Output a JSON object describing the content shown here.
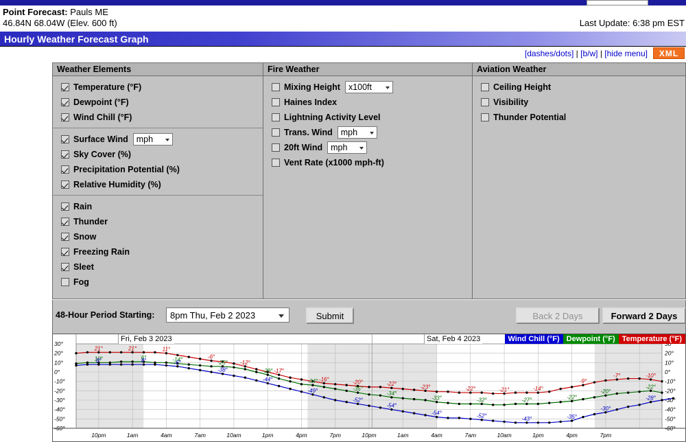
{
  "header": {
    "point_forecast_label": "Point Forecast:",
    "location": "Pauls ME",
    "coords": "46.84N 68.04W (Elev. 600 ft)",
    "last_update": "Last Update: 6:38 pm EST",
    "title": "Hourly Weather Forecast Graph"
  },
  "links": {
    "dashes_dots": "[dashes/dots]",
    "bw": "[b/w]",
    "hide_menu": "[hide menu]",
    "xml": "XML",
    "separator": "|"
  },
  "panels": [
    {
      "id": "weather-elements",
      "title": "Weather Elements",
      "groups": [
        {
          "items": [
            {
              "label": "Temperature (°F)",
              "checked": true
            },
            {
              "label": "Dewpoint (°F)",
              "checked": true
            },
            {
              "label": "Wind Chill (°F)",
              "checked": true
            }
          ]
        },
        {
          "divided": true,
          "items": [
            {
              "label": "Surface Wind",
              "checked": true,
              "select": "mph"
            },
            {
              "label": "Sky Cover (%)",
              "checked": true
            },
            {
              "label": "Precipitation Potential (%)",
              "checked": true
            },
            {
              "label": "Relative Humidity (%)",
              "checked": true
            }
          ]
        },
        {
          "divided": true,
          "items": [
            {
              "label": "Rain",
              "checked": true
            },
            {
              "label": "Thunder",
              "checked": true
            },
            {
              "label": "Snow",
              "checked": true
            },
            {
              "label": "Freezing Rain",
              "checked": true
            },
            {
              "label": "Sleet",
              "checked": true
            },
            {
              "label": "Fog",
              "checked": false
            }
          ]
        }
      ]
    },
    {
      "id": "fire-weather",
      "title": "Fire Weather",
      "groups": [
        {
          "items": [
            {
              "label": "Mixing Height",
              "checked": false,
              "select": "x100ft"
            },
            {
              "label": "Haines Index",
              "checked": false
            },
            {
              "label": "Lightning Activity Level",
              "checked": false
            },
            {
              "label": "Trans. Wind",
              "checked": false,
              "select": "mph"
            },
            {
              "label": "20ft Wind",
              "checked": false,
              "select": "mph"
            },
            {
              "label": "Vent Rate (x1000 mph-ft)",
              "checked": false
            }
          ]
        }
      ]
    },
    {
      "id": "aviation-weather",
      "title": "Aviation Weather",
      "groups": [
        {
          "items": [
            {
              "label": "Ceiling Height",
              "checked": false
            },
            {
              "label": "Visibility",
              "checked": false
            },
            {
              "label": "Thunder Potential",
              "checked": false
            }
          ]
        }
      ]
    }
  ],
  "controls": {
    "period_label": "48-Hour Period Starting:",
    "period_value": "8pm Thu, Feb 2 2023",
    "submit_label": "Submit",
    "back_label": "Back 2 Days",
    "forward_label": "Forward 2 Days"
  },
  "chart_data": {
    "type": "line",
    "title": "Hourly Weather Forecast Graph",
    "xlabel": "",
    "ylabel": "°F",
    "ylim": [
      -60,
      30
    ],
    "ytick_labels": [
      "30°",
      "20°",
      "10°",
      "0°",
      "-10°",
      "-20°",
      "-30°",
      "-40°",
      "-50°",
      "-60°"
    ],
    "yticks": [
      30,
      20,
      10,
      0,
      -10,
      -20,
      -30,
      -40,
      -50,
      -60
    ],
    "grid": true,
    "legend_position": "top-right",
    "day_labels": [
      "Fri, Feb 3 2023",
      "Sat, Feb 4 2023"
    ],
    "xtick_labels": [
      "10pm",
      "1am",
      "4am",
      "7am",
      "10am",
      "1pm",
      "4pm",
      "7pm",
      "10pm",
      "1am",
      "4am",
      "7am",
      "10am",
      "1pm",
      "4pm",
      "7pm"
    ],
    "x_hours": [
      "8pm",
      "9pm",
      "10pm",
      "11pm",
      "12am",
      "1am",
      "2am",
      "3am",
      "4am",
      "5am",
      "6am",
      "7am",
      "8am",
      "9am",
      "10am",
      "11am",
      "12pm",
      "1pm",
      "2pm",
      "3pm",
      "4pm",
      "5pm",
      "6pm",
      "7pm",
      "8pm",
      "9pm",
      "10pm",
      "11pm",
      "12am",
      "1am",
      "2am",
      "3am",
      "4am",
      "5am",
      "6am",
      "7am",
      "8am",
      "9am",
      "10am",
      "11am",
      "12pm",
      "1pm",
      "2pm",
      "3pm",
      "4pm",
      "5pm",
      "6pm",
      "7pm"
    ],
    "series": [
      {
        "name": "Temperature (°F)",
        "color": "#cc0000",
        "values": [
          20,
          21,
          21,
          21,
          21,
          21,
          21,
          21,
          20,
          18,
          16,
          14,
          12,
          11,
          9,
          6,
          3,
          0,
          -3,
          -6,
          -8,
          -10,
          -12,
          -13,
          -14,
          -15,
          -16,
          -16,
          -17,
          -18,
          -19,
          -20,
          -21,
          -21,
          -22,
          -22,
          -22,
          -23,
          -23,
          -22,
          -22,
          -22,
          -21,
          -18,
          -16,
          -14,
          -11,
          -9,
          -8,
          -7,
          -7,
          -8,
          -10
        ],
        "labels": [
          {
            "x": "10pm",
            "text": "21°"
          },
          {
            "x": "2am",
            "text": "21°"
          },
          {
            "x": "8am",
            "text": "11°"
          },
          {
            "x": "3pm",
            "text": "-6°"
          },
          {
            "x": "7pm",
            "text": "-12°"
          },
          {
            "x": "11pm",
            "text": "-17°"
          },
          {
            "x": "3am",
            "text": "-16°"
          },
          {
            "x": "7am",
            "text": "-20°"
          },
          {
            "x": "11am",
            "text": "-22°"
          },
          {
            "x": "3pm",
            "text": "-23°"
          },
          {
            "x": "7pm",
            "text": "-22°"
          },
          {
            "x": "10pm",
            "text": "-21°"
          },
          {
            "x": "2am",
            "text": "-14°"
          },
          {
            "x": "6am",
            "text": "-9°"
          },
          {
            "x": "10am",
            "text": "-7°"
          },
          {
            "x": "2pm",
            "text": "-10°"
          }
        ]
      },
      {
        "name": "Dewpoint (°F)",
        "color": "#007000",
        "values": [
          9,
          10,
          10,
          10,
          11,
          11,
          11,
          10,
          10,
          9,
          8,
          7,
          6,
          6,
          5,
          3,
          0,
          -3,
          -7,
          -10,
          -13,
          -14,
          -16,
          -18,
          -20,
          -22,
          -24,
          -25,
          -27,
          -28,
          -29,
          -30,
          -32,
          -33,
          -34,
          -34,
          -34,
          -35,
          -35,
          -34,
          -34,
          -34,
          -33,
          -32,
          -31,
          -29,
          -27,
          -25,
          -23,
          -22,
          -21,
          -20,
          -22
        ],
        "labels": [
          {
            "x": "12am",
            "text": "10°"
          },
          {
            "x": "8am",
            "text": "6°"
          },
          {
            "x": "5pm",
            "text": "-14°"
          },
          {
            "x": "11pm",
            "text": "-25°"
          },
          {
            "x": "3am",
            "text": "-29°"
          },
          {
            "x": "7am",
            "text": "-34°"
          },
          {
            "x": "11am",
            "text": "-35°"
          },
          {
            "x": "3pm",
            "text": "-34°"
          },
          {
            "x": "7pm",
            "text": "-33°"
          },
          {
            "x": "10pm",
            "text": "-32°"
          },
          {
            "x": "2am",
            "text": "-27°"
          },
          {
            "x": "6am",
            "text": "-22°"
          },
          {
            "x": "10am",
            "text": "-20°"
          },
          {
            "x": "2pm",
            "text": "-22°"
          }
        ]
      },
      {
        "name": "Wind Chill (°F)",
        "color": "#0000c8",
        "values": [
          7,
          8,
          8,
          8,
          8,
          8,
          8,
          8,
          7,
          6,
          4,
          2,
          0,
          -2,
          -4,
          -6,
          -9,
          -12,
          -15,
          -18,
          -21,
          -24,
          -27,
          -30,
          -32,
          -34,
          -36,
          -38,
          -40,
          -42,
          -44,
          -46,
          -48,
          -49,
          -49,
          -50,
          -51,
          -52,
          -53,
          -54,
          -54,
          -54,
          -54,
          -53,
          -52,
          -48,
          -45,
          -43,
          -40,
          -37,
          -35,
          -32,
          -30,
          -28
        ],
        "labels": [
          {
            "x": "11pm",
            "text": "8°"
          },
          {
            "x": "3am",
            "text": "8°"
          },
          {
            "x": "9am",
            "text": "-6°"
          },
          {
            "x": "4pm",
            "text": "-38°"
          },
          {
            "x": "9pm",
            "text": "-44°"
          },
          {
            "x": "2am",
            "text": "-49°"
          },
          {
            "x": "6am",
            "text": "-52°"
          },
          {
            "x": "10am",
            "text": "-54°"
          },
          {
            "x": "2pm",
            "text": "-54°"
          },
          {
            "x": "6pm",
            "text": "-52°"
          },
          {
            "x": "10pm",
            "text": "-43°"
          },
          {
            "x": "2am",
            "text": "-35°"
          },
          {
            "x": "6am",
            "text": "-30°"
          },
          {
            "x": "10am",
            "text": "-28°"
          }
        ]
      }
    ],
    "shaded_night_bands": [
      [
        0,
        0.115
      ],
      [
        0.395,
        0.615
      ],
      [
        0.885,
        1.0
      ]
    ]
  }
}
